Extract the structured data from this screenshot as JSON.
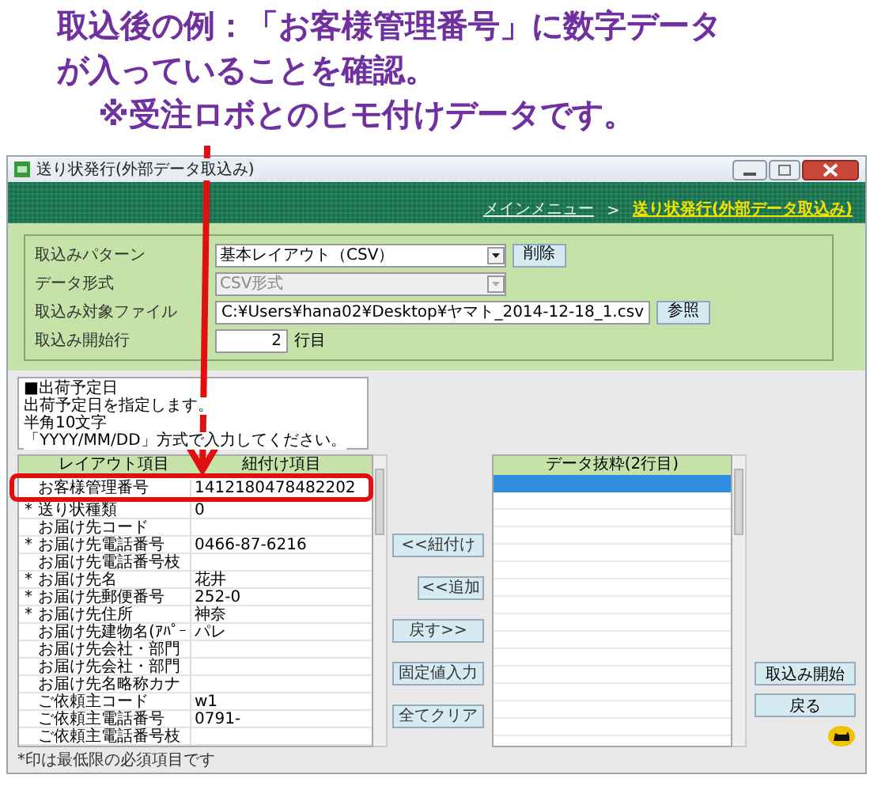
{
  "annotation": {
    "lines": [
      "取込後の例：「お客様管理番号」に数字データ",
      "が入っていることを確認。",
      "※受注ロボとのヒモ付けデータです。"
    ]
  },
  "window": {
    "title": "送り状発行(外部データ取込み)"
  },
  "breadcrumb": {
    "link": "メインメニュー",
    "separator": ">",
    "current": "送り状発行(外部データ取込み)"
  },
  "form": [
    {
      "kind": "combo",
      "label": "取込みパターン",
      "value": "基本レイアウト（CSV）",
      "disabled": false,
      "button": "削除"
    },
    {
      "kind": "combo",
      "label": "データ形式",
      "value": "CSV形式",
      "disabled": true
    },
    {
      "kind": "file",
      "label": "取込み対象ファイル",
      "value": "C:¥Users¥hana02¥Desktop¥ヤマト_2014-12-18_1.csv",
      "button": "参照"
    },
    {
      "kind": "number",
      "label": "取込み開始行",
      "value": "2",
      "suffix": "行目"
    }
  ],
  "hint": [
    "■出荷予定日",
    "出荷予定日を指定します。",
    "半角10文字",
    "「YYYY/MM/DD」方式で入力してください。"
  ],
  "layout_table": {
    "columns": [
      "レイアウト項目",
      "紐付け項目"
    ],
    "rows": [
      {
        "mark": "",
        "item": "お客様管理番号",
        "linked": "1412180478482202"
      },
      {
        "mark": "*",
        "item": "送り状種類",
        "linked": "0"
      },
      {
        "mark": "",
        "item": "お届け先コード",
        "linked": ""
      },
      {
        "mark": "*",
        "item": "お届け先電話番号",
        "linked": "0466-87-6216"
      },
      {
        "mark": "",
        "item": "お届け先電話番号枝",
        "linked": ""
      },
      {
        "mark": "*",
        "item": "お届け先名",
        "linked": "花井"
      },
      {
        "mark": "*",
        "item": "お届け先郵便番号",
        "linked": "252-0"
      },
      {
        "mark": "*",
        "item": "お届け先住所",
        "linked": "神奈"
      },
      {
        "mark": "",
        "item": "お届け先建物名(ｱﾊﾟｰ",
        "linked": "パレ"
      },
      {
        "mark": "",
        "item": "お届け先会社・部門",
        "linked": ""
      },
      {
        "mark": "",
        "item": "お届け先会社・部門",
        "linked": ""
      },
      {
        "mark": "",
        "item": "お届け先名略称カナ",
        "linked": ""
      },
      {
        "mark": "",
        "item": "ご依頼主コード",
        "linked": "w1"
      },
      {
        "mark": "",
        "item": "ご依頼主電話番号",
        "linked": "0791-"
      },
      {
        "mark": "",
        "item": "ご依頼主電話番号枝",
        "linked": ""
      }
    ]
  },
  "middle_buttons": [
    "<<紐付け",
    "<<追加",
    "戻す>>",
    "固定値入力",
    "全てクリア"
  ],
  "data_table": {
    "column": "データ抜粋(2行目)",
    "rows": [
      {
        "selected": true
      },
      {
        "selected": false
      },
      {
        "selected": false
      },
      {
        "selected": false
      },
      {
        "selected": false
      },
      {
        "selected": false
      },
      {
        "selected": false
      },
      {
        "selected": false
      },
      {
        "selected": false
      },
      {
        "selected": false
      },
      {
        "selected": false
      },
      {
        "selected": false
      },
      {
        "selected": false
      },
      {
        "selected": false
      },
      {
        "selected": false
      }
    ]
  },
  "action_buttons": [
    "取込み開始",
    "戻る"
  ],
  "status_bar": "*印は最低限の必須項目です"
}
